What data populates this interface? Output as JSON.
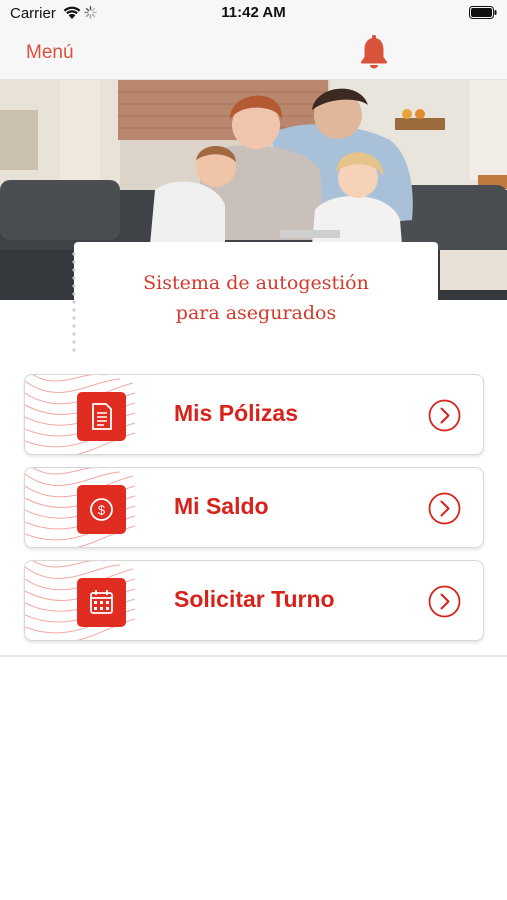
{
  "status_bar": {
    "carrier": "Carrier",
    "time": "11:42 AM",
    "wifi_icon": "wifi-icon",
    "battery_icon": "battery-icon"
  },
  "nav": {
    "menu_label": "Menú",
    "bell_icon": "bell-icon",
    "accent_color": "#d9533a"
  },
  "hero": {
    "image": "family-photo",
    "title_line1": "Sistema de autogestión",
    "title_line2": "para asegurados"
  },
  "menu": {
    "items": [
      {
        "label": "Mis Pólizas",
        "icon": "document-icon"
      },
      {
        "label": "Mi Saldo",
        "icon": "dollar-coin-icon"
      },
      {
        "label": "Solicitar Turno",
        "icon": "calendar-icon"
      }
    ],
    "chevron_icon": "chevron-right-circle-icon",
    "brand_color": "#e02c21"
  }
}
